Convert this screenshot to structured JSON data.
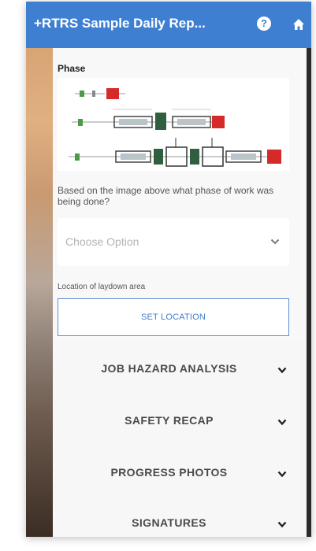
{
  "header": {
    "title": "+RTRS Sample Daily Rep...",
    "help_icon": "question-circle-icon",
    "home_icon": "home-icon",
    "color": "#3f7fd1"
  },
  "phase": {
    "label": "Phase",
    "question": "Based on the image above what phase of work was being done?",
    "select_placeholder": "Choose Option"
  },
  "location": {
    "label": "Location of laydown area",
    "button_label": "SET LOCATION"
  },
  "sections": [
    {
      "label": "JOB HAZARD ANALYSIS"
    },
    {
      "label": "SAFETY RECAP"
    },
    {
      "label": "PROGRESS PHOTOS"
    },
    {
      "label": "SIGNATURES"
    }
  ]
}
